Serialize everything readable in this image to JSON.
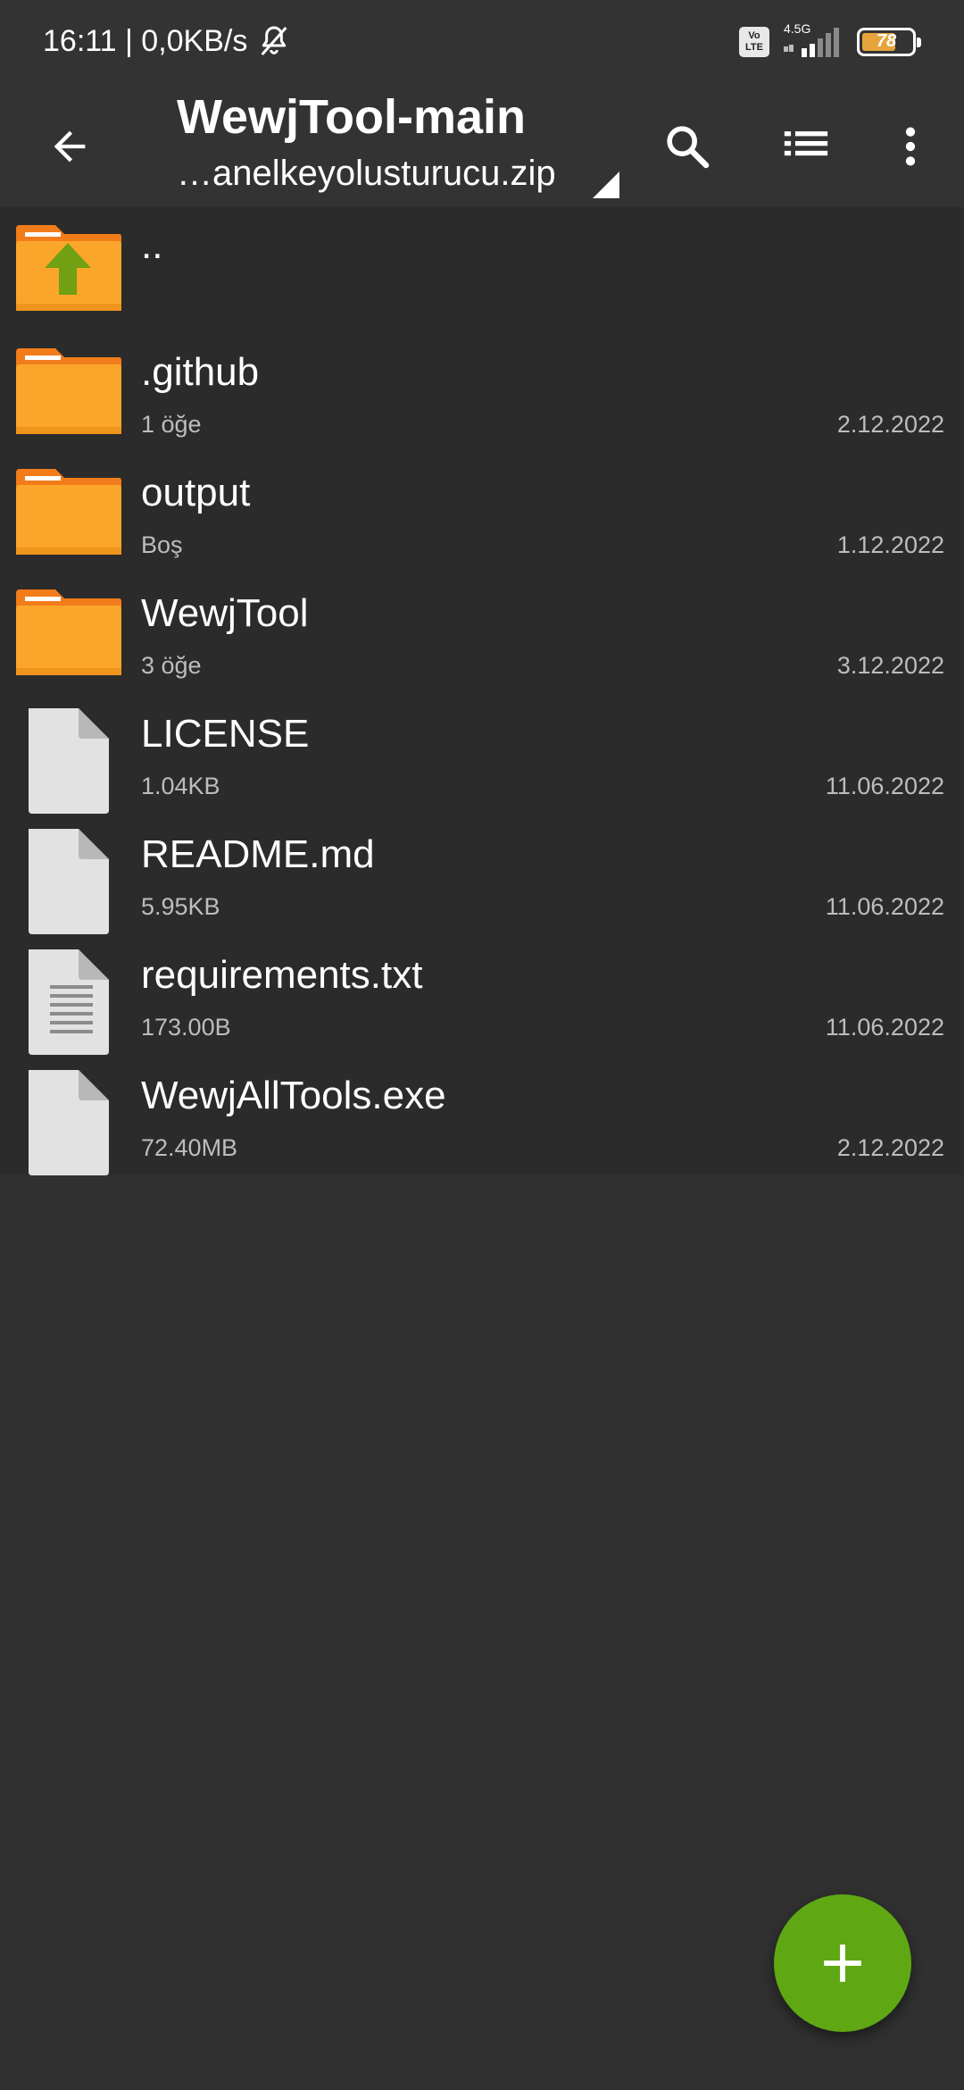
{
  "status_bar": {
    "time_speed": "16:11 | 0,0KB/s",
    "volte_line1": "Vo",
    "volte_line2": "LTE",
    "network": "4.5G",
    "battery_level": "78",
    "battery_fraction": 0.78,
    "battery_color": "#e7a43c"
  },
  "toolbar": {
    "title": "WewjTool-main",
    "subtitle": "…anelkeyolusturucu.zip",
    "icons": [
      "back-arrow-icon",
      "search-icon",
      "list-view-icon",
      "more-vert-icon"
    ]
  },
  "files": [
    {
      "name": "..",
      "meta": "",
      "date": "",
      "type": "parent-folder"
    },
    {
      "name": ".github",
      "meta": "1 öğe",
      "date": "2.12.2022",
      "type": "folder"
    },
    {
      "name": "output",
      "meta": "Boş",
      "date": "1.12.2022",
      "type": "folder"
    },
    {
      "name": "WewjTool",
      "meta": "3 öğe",
      "date": "3.12.2022",
      "type": "folder"
    },
    {
      "name": "LICENSE",
      "meta": "1.04KB",
      "date": "11.06.2022",
      "type": "file"
    },
    {
      "name": "README.md",
      "meta": "5.95KB",
      "date": "11.06.2022",
      "type": "file"
    },
    {
      "name": "requirements.txt",
      "meta": "173.00B",
      "date": "11.06.2022",
      "type": "text-file"
    },
    {
      "name": "WewjAllTools.exe",
      "meta": "72.40MB",
      "date": "2.12.2022",
      "type": "file"
    }
  ],
  "fab": {
    "icon": "plus-icon",
    "color": "#5fa813"
  },
  "colors": {
    "folder": "#fba62a",
    "folder_tab": "#f37c1a",
    "accent_green": "#5fa813",
    "background": "#303030"
  }
}
